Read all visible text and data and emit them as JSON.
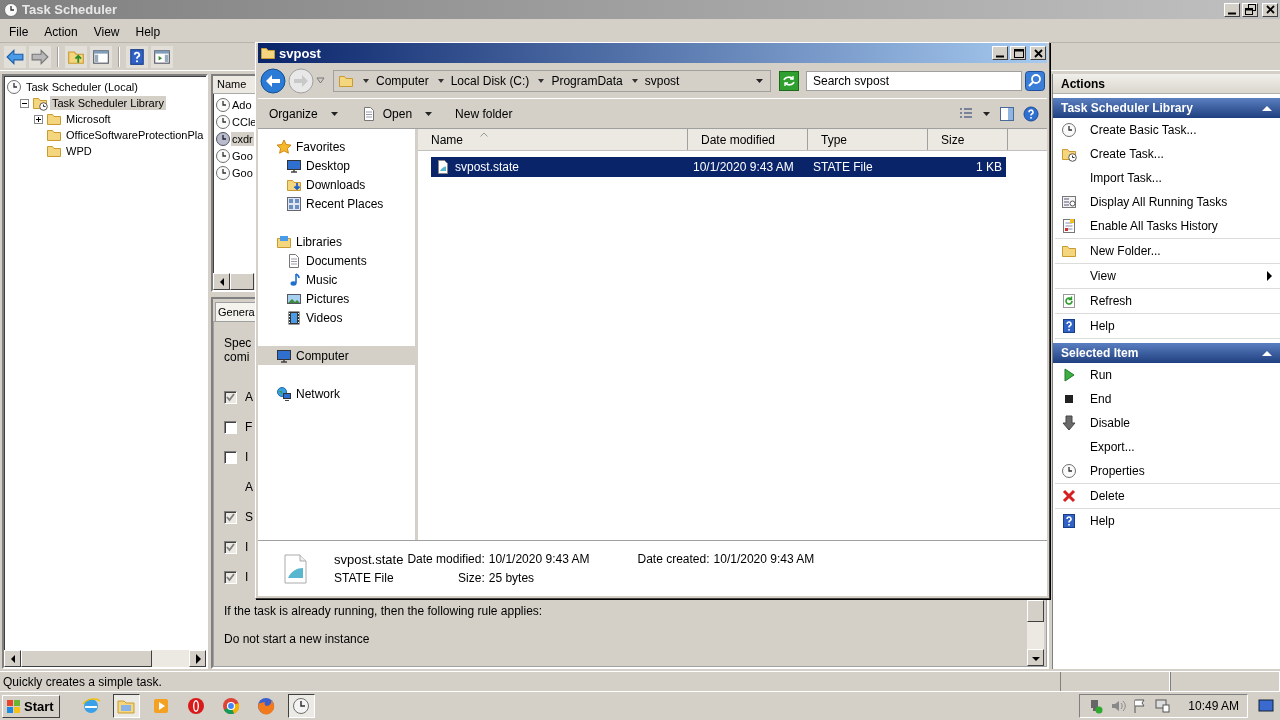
{
  "task_scheduler": {
    "title": "Task Scheduler",
    "menu": [
      "File",
      "Action",
      "View",
      "Help"
    ],
    "tree": [
      {
        "label": "Task Scheduler (Local)",
        "kind": "root",
        "selected": false,
        "children": [
          {
            "label": "Task Scheduler Library",
            "kind": "branch",
            "expanded": true,
            "selected": true,
            "children": [
              {
                "label": "Microsoft",
                "kind": "branch",
                "expanded": false,
                "selected": false
              },
              {
                "label": "OfficeSoftwareProtectionPla",
                "kind": "leaf",
                "selected": false
              },
              {
                "label": "WPD",
                "kind": "leaf",
                "selected": false
              }
            ]
          }
        ]
      }
    ],
    "task_list": {
      "columns": [
        "Name"
      ],
      "rows": [
        {
          "name": "Ado",
          "selected": false
        },
        {
          "name": "CCle",
          "selected": false
        },
        {
          "name": "cxdr",
          "selected": true
        },
        {
          "name": "Goo",
          "selected": false
        },
        {
          "name": "Goo",
          "selected": false
        }
      ]
    },
    "properties": {
      "tabs": [
        {
          "label": "Genera",
          "selected": true
        }
      ],
      "description": [
        "Spec",
        "comi"
      ],
      "options": [
        {
          "kind": "checkbox",
          "label": "A",
          "checked": true
        },
        {
          "kind": "checkbox",
          "label": "F",
          "checked": false
        },
        {
          "kind": "checkbox",
          "label": "I",
          "checked": false
        },
        {
          "kind": "text",
          "label": "A"
        },
        {
          "kind": "checkbox",
          "label": "S",
          "checked": true
        },
        {
          "kind": "checkbox",
          "label": "I",
          "checked": true
        },
        {
          "kind": "checkbox",
          "label": "I",
          "checked": true
        }
      ],
      "rule_label": "If the task is already running, then the following rule applies:",
      "rule_value": "Do not start a new instance"
    },
    "actions": {
      "title": "Actions",
      "sections": [
        {
          "title": "Task Scheduler Library",
          "expanded": true,
          "groups": [
            [
              {
                "label": "Create Basic Task...",
                "kind": "command"
              },
              {
                "label": "Create Task...",
                "kind": "command"
              },
              {
                "label": "Import Task...",
                "kind": "command"
              },
              {
                "label": "Display All Running Tasks",
                "kind": "command"
              },
              {
                "label": "Enable All Tasks History",
                "kind": "command"
              }
            ],
            [
              {
                "label": "New Folder...",
                "kind": "command"
              }
            ],
            [
              {
                "label": "View",
                "kind": "submenu"
              }
            ],
            [
              {
                "label": "Refresh",
                "kind": "command"
              }
            ],
            [
              {
                "label": "Help",
                "kind": "command"
              }
            ]
          ]
        },
        {
          "title": "Selected Item",
          "expanded": true,
          "groups": [
            [
              {
                "label": "Run",
                "kind": "command"
              },
              {
                "label": "End",
                "kind": "command"
              },
              {
                "label": "Disable",
                "kind": "command"
              },
              {
                "label": "Export...",
                "kind": "command"
              },
              {
                "label": "Properties",
                "kind": "command"
              }
            ],
            [
              {
                "label": "Delete",
                "kind": "command"
              }
            ],
            [
              {
                "label": "Help",
                "kind": "command"
              }
            ]
          ]
        }
      ]
    },
    "status_bar": {
      "text": "Quickly creates a simple task."
    }
  },
  "explorer": {
    "title": "svpost",
    "breadcrumb": [
      "Computer",
      "Local Disk (C:)",
      "ProgramData",
      "svpost"
    ],
    "search": {
      "placeholder": "Search svpost"
    },
    "toolbar": [
      {
        "label": "Organize",
        "dropdown": true
      },
      {
        "label": "Open",
        "dropdown": true
      },
      {
        "label": "New folder",
        "dropdown": false
      }
    ],
    "nav": [
      {
        "label": "Favorites",
        "selected": false,
        "children": [
          {
            "label": "Desktop",
            "selected": false
          },
          {
            "label": "Downloads",
            "selected": false
          },
          {
            "label": "Recent Places",
            "selected": false
          }
        ]
      },
      {
        "label": "Libraries",
        "selected": false,
        "children": [
          {
            "label": "Documents",
            "selected": false
          },
          {
            "label": "Music",
            "selected": false
          },
          {
            "label": "Pictures",
            "selected": false
          },
          {
            "label": "Videos",
            "selected": false
          }
        ]
      },
      {
        "label": "Computer",
        "selected": true
      },
      {
        "label": "Network",
        "selected": false
      }
    ],
    "columns": [
      {
        "label": "Name",
        "sorted": true
      },
      {
        "label": "Date modified",
        "sorted": false
      },
      {
        "label": "Type",
        "sorted": false
      },
      {
        "label": "Size",
        "sorted": false
      }
    ],
    "files": [
      {
        "name": "svpost.state",
        "date_modified": "10/1/2020 9:43 AM",
        "type": "STATE File",
        "size": "1 KB",
        "selected": true
      }
    ],
    "details": {
      "name": "svpost.state",
      "type": "STATE File",
      "fields": [
        {
          "label": "Date modified:",
          "value": "10/1/2020 9:43 AM"
        },
        {
          "label": "Size:",
          "value": "25 bytes"
        },
        {
          "label": "Date created:",
          "value": "10/1/2020 9:43 AM"
        }
      ]
    }
  },
  "taskbar": {
    "start": "Start",
    "apps": [
      {
        "active": false
      },
      {
        "active": true
      },
      {
        "active": false
      },
      {
        "active": false
      },
      {
        "active": false
      },
      {
        "active": false
      },
      {
        "active": true
      }
    ],
    "clock": "10:49 AM"
  }
}
